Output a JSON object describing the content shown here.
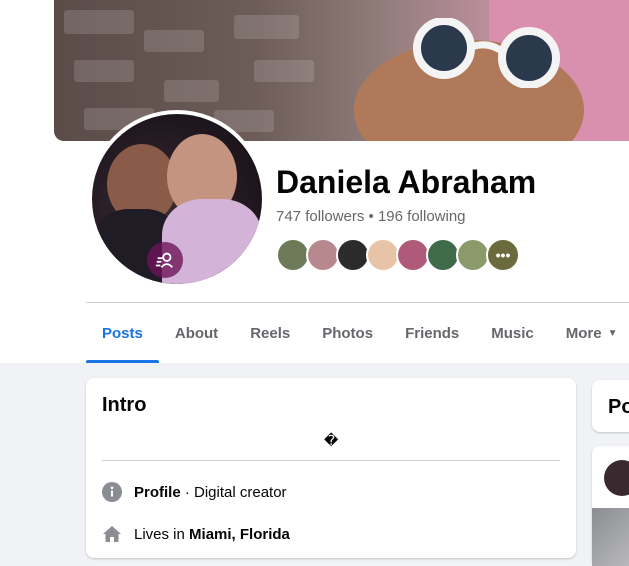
{
  "profile": {
    "name": "Daniela Abraham",
    "followers_line": "747 followers • 196 following",
    "friend_avatar_colors": [
      "#6c7a5a",
      "#b7898e",
      "#2b2b2b",
      "#e7c3a8",
      "#b05a7a",
      "#3f6b4a",
      "#8a9a6a"
    ],
    "more_friends_symbol": "•••"
  },
  "tabs": [
    {
      "label": "Posts",
      "active": true
    },
    {
      "label": "About"
    },
    {
      "label": "Reels"
    },
    {
      "label": "Photos"
    },
    {
      "label": "Friends"
    },
    {
      "label": "Music"
    },
    {
      "label": "More"
    }
  ],
  "intro": {
    "title": "Intro",
    "glyph": "�",
    "rows": [
      {
        "icon": "info-icon",
        "strong": "Profile",
        "rest": " · Digital creator"
      },
      {
        "icon": "home-icon",
        "prefix": "Lives in ",
        "strong": "Miami, Florida"
      }
    ]
  },
  "right_panel": {
    "title_partial": "Po"
  },
  "colors": {
    "accent": "#1b74e4",
    "text_secondary": "#65676b",
    "page_bg": "#f0f2f5"
  }
}
